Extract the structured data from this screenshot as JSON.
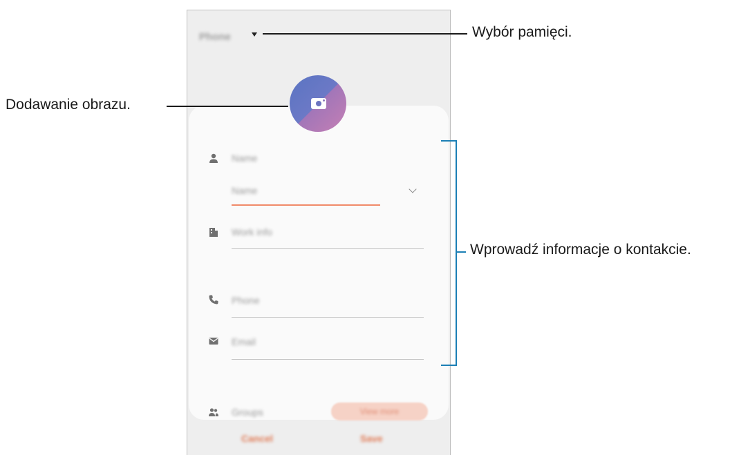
{
  "screen": {
    "storage_selector": "Phone",
    "fields": {
      "name_placeholder": "Name",
      "name_sub_placeholder": "Name",
      "work_info_placeholder": "Work info",
      "phone_placeholder": "Phone",
      "email_placeholder": "Email"
    },
    "groups_label": "Groups",
    "view_more_label": "View more",
    "cancel_label": "Cancel",
    "save_label": "Save"
  },
  "callouts": {
    "storage": "Wybór pamięci.",
    "image": "Dodawanie obrazu.",
    "info": "Wprowadź informacje o kontakcie."
  },
  "colors": {
    "accent_line": "#f08a68",
    "bracket": "#1b7fb5",
    "avatar_gradient": [
      "#5a74c2",
      "#c57fb4"
    ]
  },
  "icons": [
    "camera-icon",
    "person-icon",
    "building-icon",
    "phone-icon",
    "email-icon",
    "groups-icon",
    "chevron-down-icon",
    "dropdown-arrow-icon"
  ]
}
